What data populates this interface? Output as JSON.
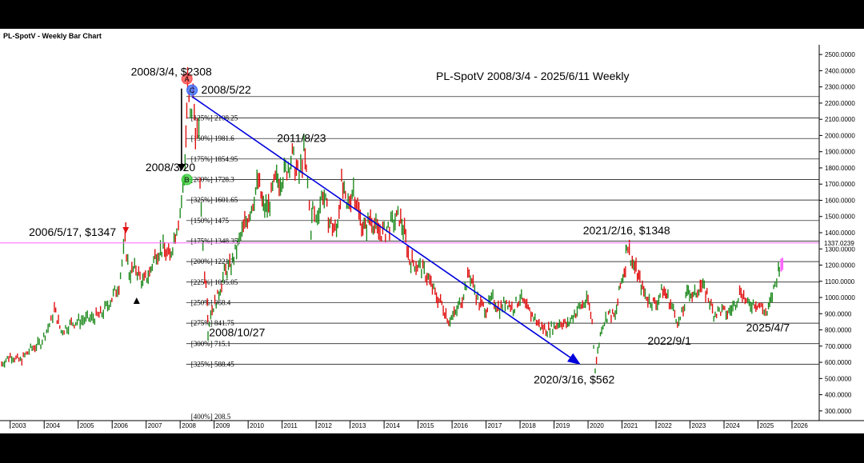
{
  "panel_title": "PL-SpotV - Weekly Bar Chart",
  "chart_data": {
    "type": "bar",
    "title": "PL-SpotV 2008/3/4 - 2025/6/11 Weekly",
    "x_ticks": [
      "2003",
      "2004",
      "2005",
      "2006",
      "2007",
      "2008",
      "2009",
      "2010",
      "2011",
      "2012",
      "2013",
      "2014",
      "2015",
      "2016",
      "2017",
      "2018",
      "2019",
      "2020",
      "2021",
      "2022",
      "2023",
      "2024",
      "2025",
      "2026"
    ],
    "y_ticks": [
      "2500.0000",
      "2400.0000",
      "2300.0000",
      "2200.0000",
      "2100.0000",
      "2000.0000",
      "1900.0000",
      "1800.0000",
      "1700.0000",
      "1600.0000",
      "1500.0000",
      "1400.0000",
      "1300.0000",
      "1200.0000",
      "1100.0000",
      "1000.0000",
      "900.0000",
      "800.0000",
      "700.0000",
      "600.0000",
      "500.0000",
      "400.0000",
      "300.0000"
    ],
    "ylim": [
      240,
      2560
    ],
    "xlim": [
      2002.7,
      2026.8
    ],
    "current_price_label": "1337.0239",
    "current_price": 1337,
    "colors": {
      "up": "#1f8a1f",
      "down": "#e01010",
      "trend_line": "#0000dd",
      "price_line": "#ff66ff"
    },
    "price_path": [
      [
        2002.75,
        590
      ],
      [
        2003.0,
        640
      ],
      [
        2003.3,
        610
      ],
      [
        2003.6,
        680
      ],
      [
        2003.9,
        720
      ],
      [
        2004.2,
        850
      ],
      [
        2004.3,
        930
      ],
      [
        2004.5,
        790
      ],
      [
        2004.8,
        840
      ],
      [
        2005.1,
        860
      ],
      [
        2005.4,
        870
      ],
      [
        2005.7,
        900
      ],
      [
        2005.95,
        980
      ],
      [
        2006.2,
        1080
      ],
      [
        2006.38,
        1347
      ],
      [
        2006.5,
        1150
      ],
      [
        2006.7,
        1180
      ],
      [
        2006.9,
        1090
      ],
      [
        2007.1,
        1150
      ],
      [
        2007.3,
        1280
      ],
      [
        2007.5,
        1300
      ],
      [
        2007.7,
        1250
      ],
      [
        2007.9,
        1440
      ],
      [
        2008.0,
        1530
      ],
      [
        2008.12,
        1728
      ],
      [
        2008.17,
        2000
      ],
      [
        2008.22,
        2308
      ],
      [
        2008.3,
        2100
      ],
      [
        2008.38,
        2240
      ],
      [
        2008.45,
        2050
      ],
      [
        2008.55,
        1980
      ],
      [
        2008.62,
        1500
      ],
      [
        2008.72,
        1150
      ],
      [
        2008.8,
        1000
      ],
      [
        2008.82,
        790
      ],
      [
        2008.9,
        910
      ],
      [
        2009.1,
        1000
      ],
      [
        2009.3,
        1150
      ],
      [
        2009.5,
        1200
      ],
      [
        2009.7,
        1320
      ],
      [
        2009.9,
        1450
      ],
      [
        2010.1,
        1560
      ],
      [
        2010.3,
        1720
      ],
      [
        2010.45,
        1550
      ],
      [
        2010.6,
        1560
      ],
      [
        2010.8,
        1720
      ],
      [
        2010.95,
        1730
      ],
      [
        2011.1,
        1780
      ],
      [
        2011.3,
        1870
      ],
      [
        2011.5,
        1740
      ],
      [
        2011.64,
        1900
      ],
      [
        2011.75,
        1700
      ],
      [
        2011.85,
        1420
      ],
      [
        2011.9,
        1550
      ],
      [
        2012.0,
        1480
      ],
      [
        2012.2,
        1650
      ],
      [
        2012.4,
        1460
      ],
      [
        2012.6,
        1410
      ],
      [
        2012.75,
        1700
      ],
      [
        2012.9,
        1550
      ],
      [
        2013.1,
        1680
      ],
      [
        2013.3,
        1480
      ],
      [
        2013.45,
        1420
      ],
      [
        2013.6,
        1500
      ],
      [
        2013.8,
        1410
      ],
      [
        2014.0,
        1400
      ],
      [
        2014.2,
        1450
      ],
      [
        2014.45,
        1500
      ],
      [
        2014.6,
        1400
      ],
      [
        2014.75,
        1230
      ],
      [
        2014.9,
        1210
      ],
      [
        2015.1,
        1180
      ],
      [
        2015.3,
        1120
      ],
      [
        2015.5,
        1020
      ],
      [
        2015.7,
        960
      ],
      [
        2015.9,
        860
      ],
      [
        2016.1,
        900
      ],
      [
        2016.3,
        1000
      ],
      [
        2016.5,
        1150
      ],
      [
        2016.62,
        1080
      ],
      [
        2016.8,
        960
      ],
      [
        2017.0,
        930
      ],
      [
        2017.2,
        990
      ],
      [
        2017.4,
        930
      ],
      [
        2017.6,
        980
      ],
      [
        2017.8,
        930
      ],
      [
        2018.0,
        1000
      ],
      [
        2018.2,
        930
      ],
      [
        2018.4,
        880
      ],
      [
        2018.6,
        820
      ],
      [
        2018.8,
        800
      ],
      [
        2019.0,
        820
      ],
      [
        2019.2,
        850
      ],
      [
        2019.4,
        830
      ],
      [
        2019.6,
        900
      ],
      [
        2019.8,
        950
      ],
      [
        2020.0,
        980
      ],
      [
        2020.12,
        850
      ],
      [
        2020.21,
        562
      ],
      [
        2020.4,
        820
      ],
      [
        2020.6,
        900
      ],
      [
        2020.8,
        880
      ],
      [
        2020.95,
        1070
      ],
      [
        2021.1,
        1200
      ],
      [
        2021.13,
        1348
      ],
      [
        2021.3,
        1220
      ],
      [
        2021.45,
        1150
      ],
      [
        2021.6,
        1050
      ],
      [
        2021.8,
        980
      ],
      [
        2022.0,
        960
      ],
      [
        2022.2,
        1050
      ],
      [
        2022.35,
        1000
      ],
      [
        2022.55,
        900
      ],
      [
        2022.67,
        840
      ],
      [
        2022.8,
        920
      ],
      [
        2022.95,
        1050
      ],
      [
        2023.1,
        1000
      ],
      [
        2023.3,
        1080
      ],
      [
        2023.5,
        1020
      ],
      [
        2023.7,
        900
      ],
      [
        2023.9,
        920
      ],
      [
        2024.1,
        900
      ],
      [
        2024.3,
        950
      ],
      [
        2024.5,
        1050
      ],
      [
        2024.7,
        950
      ],
      [
        2024.9,
        970
      ],
      [
        2025.05,
        950
      ],
      [
        2025.27,
        900
      ],
      [
        2025.38,
        980
      ],
      [
        2025.5,
        1080
      ],
      [
        2025.6,
        1170
      ],
      [
        2025.65,
        1230
      ]
    ],
    "extra_bars": [
      [
        2025.68,
        1240,
        1160,
        "#ff66ff"
      ],
      [
        2025.72,
        1245,
        1170,
        "#ff66ff"
      ]
    ],
    "trend_line": [
      [
        2008.35,
        2240
      ],
      [
        2019.75,
        590
      ]
    ],
    "fib_levels": [
      {
        "value": 2240,
        "label": ""
      },
      {
        "value": 2108.25,
        "label": "[125%] 2108.25"
      },
      {
        "value": 1981.6,
        "label": "[150%] 1981.6"
      },
      {
        "value": 1854.95,
        "label": "[175%] 1854.95"
      },
      {
        "value": 1728.3,
        "label": "[200%] 1728.3"
      },
      {
        "value": 1601.65,
        "label": "[325%] 1601.65"
      },
      {
        "value": 1475,
        "label": "[150%] 1475"
      },
      {
        "value": 1348.35,
        "label": "[175%] 1348.35"
      },
      {
        "value": 1221.7,
        "label": "[200%] 1221.7"
      },
      {
        "value": 1095.05,
        "label": "[225%] 1095.05"
      },
      {
        "value": 968.4,
        "label": "[250%] 968.4"
      },
      {
        "value": 841.75,
        "label": "[275%] 841.75"
      },
      {
        "value": 715.1,
        "label": "[300%] 715.1"
      },
      {
        "value": 588.45,
        "label": "[325%] 588.45"
      },
      {
        "value": 208.5,
        "label": "[400%] 208.5"
      }
    ],
    "annotations": [
      {
        "text": "2008/3/4, $2308",
        "x": 2006.55,
        "y": 2370
      },
      {
        "text": "2008/5/22",
        "x": 2008.62,
        "y": 2260
      },
      {
        "text": "2008/3/20",
        "x": 2006.98,
        "y": 1780
      },
      {
        "text": "2011/8/23",
        "x": 2010.85,
        "y": 1960
      },
      {
        "text": "2006/5/17, $1347",
        "x": 2003.55,
        "y": 1380
      },
      {
        "text": "2008/10/27",
        "x": 2008.85,
        "y": 760
      },
      {
        "text": "2021/2/16, $1348",
        "x": 2019.85,
        "y": 1390
      },
      {
        "text": "2022/9/1",
        "x": 2021.75,
        "y": 710
      },
      {
        "text": "2025/4/7",
        "x": 2024.65,
        "y": 790
      },
      {
        "text": "2020/3/16, $562",
        "x": 2018.4,
        "y": 470
      }
    ],
    "markers": [
      {
        "letter": "A",
        "x": 2008.2,
        "y": 2350,
        "color": "#ff4444"
      },
      {
        "letter": "C",
        "x": 2008.35,
        "y": 2280,
        "color": "#3366ff"
      },
      {
        "letter": "B",
        "x": 2008.2,
        "y": 1728,
        "color": "#33cc33"
      }
    ]
  }
}
